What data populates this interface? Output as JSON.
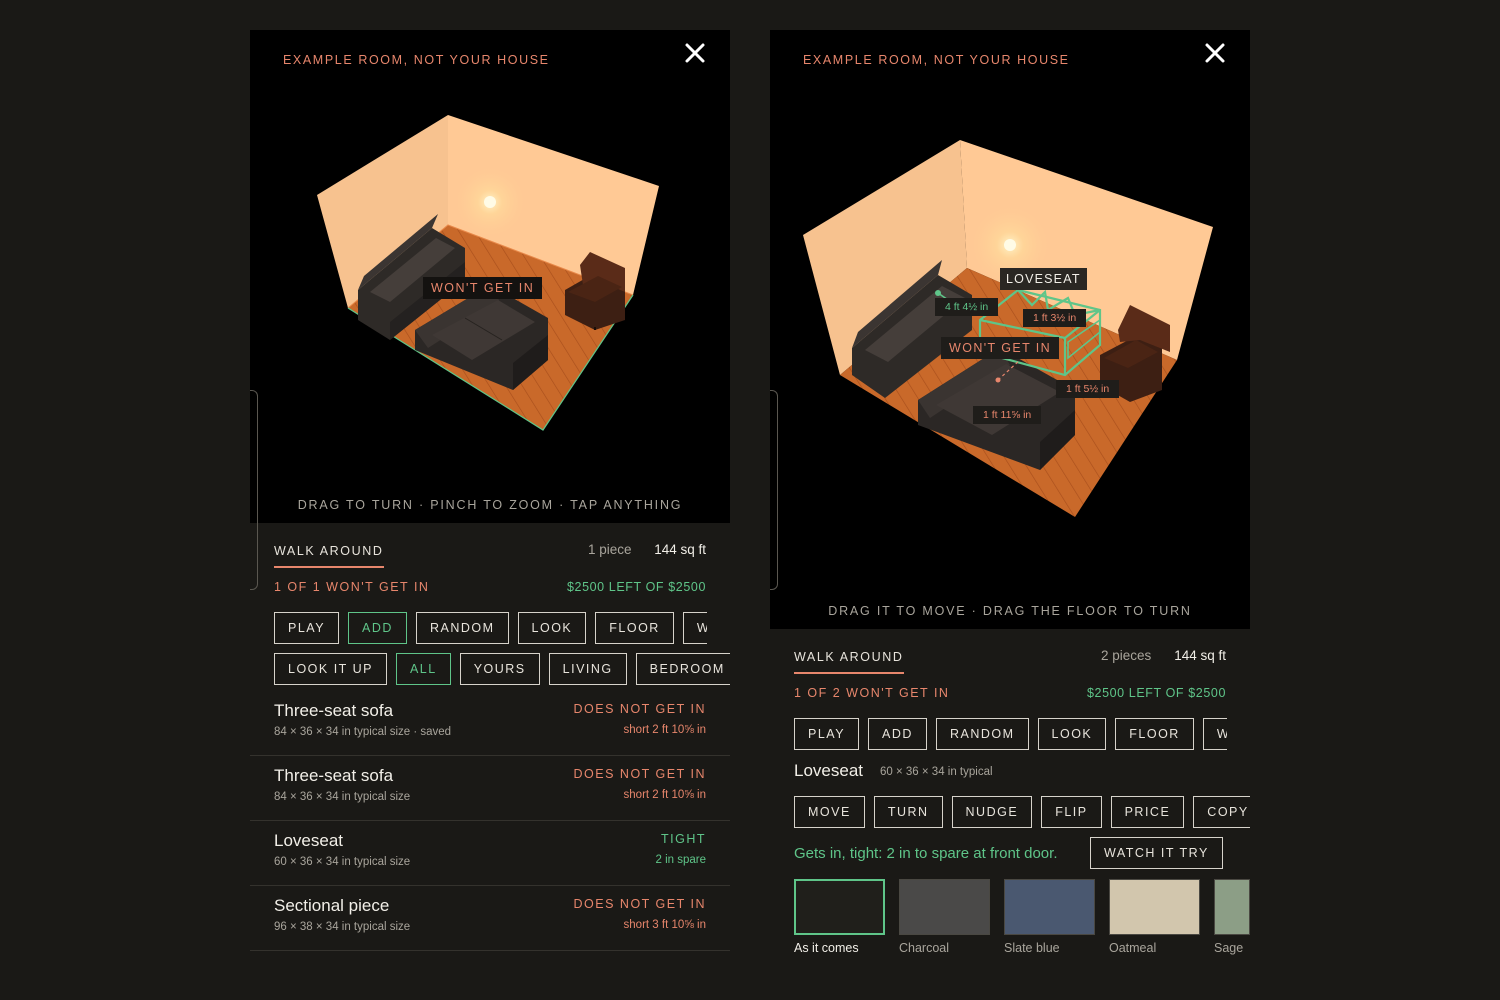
{
  "left": {
    "scene_title": "EXAMPLE ROOM, NOT YOUR HOUSE",
    "close_icon": "close-icon",
    "wont_label": "WON'T GET IN",
    "hint": "DRAG TO TURN · PINCH TO ZOOM · TAP ANYTHING",
    "tab": "WALK AROUND",
    "piece_count": "1 piece",
    "area": "144 sq ft",
    "status_left": "1 OF 1 WON'T GET IN",
    "status_right": "$2500 LEFT OF $2500",
    "actions": [
      "PLAY",
      "ADD",
      "RANDOM",
      "LOOK",
      "FLOOR",
      "WAL"
    ],
    "filters": [
      "LOOK IT UP",
      "ALL",
      "YOURS",
      "LIVING",
      "BEDROOM",
      ""
    ],
    "items": [
      {
        "name": "Three-seat sofa",
        "sub": "84 × 36 × 34 in  typical size  · saved",
        "status": "DOES NOT GET IN",
        "detail": "short 2 ft 10⅝ in",
        "ok": false
      },
      {
        "name": "Three-seat sofa",
        "sub": "84 × 36 × 34 in  typical size",
        "status": "DOES NOT GET IN",
        "detail": "short 2 ft 10⅝ in",
        "ok": false
      },
      {
        "name": "Loveseat",
        "sub": "60 × 36 × 34 in  typical size",
        "status": "TIGHT",
        "detail": "2 in spare",
        "ok": true
      },
      {
        "name": "Sectional piece",
        "sub": "96 × 38 × 34 in  typical size",
        "status": "DOES NOT GET IN",
        "detail": "short 3 ft 10⅝ in",
        "ok": false
      }
    ]
  },
  "right": {
    "scene_title": "EXAMPLE ROOM, NOT YOUR HOUSE",
    "close_icon": "close-icon",
    "loveseat_label": "LOVESEAT",
    "wont_label": "WON'T GET IN",
    "dims": [
      "4 ft 4½ in",
      "1 ft 3½ in",
      "1 ft 5½ in",
      "1 ft 11⅝ in"
    ],
    "hint": "DRAG IT TO MOVE · DRAG THE FLOOR TO TURN",
    "tab": "WALK AROUND",
    "piece_count": "2 pieces",
    "area": "144 sq ft",
    "status_left": "1 OF 2 WON'T GET IN",
    "status_right": "$2500 LEFT OF $2500",
    "actions": [
      "PLAY",
      "ADD",
      "RANDOM",
      "LOOK",
      "FLOOR",
      "WAL"
    ],
    "selected_name": "Loveseat",
    "selected_dims": "60 × 36 × 34 in  typical",
    "tools": [
      "MOVE",
      "TURN",
      "NUDGE",
      "FLIP",
      "PRICE",
      "COPY"
    ],
    "message": "Gets in, tight: 2 in to spare at front door.",
    "watch_btn": "WATCH IT TRY",
    "swatches": [
      {
        "label": "As it comes",
        "color": "#201f1b"
      },
      {
        "label": "Charcoal",
        "color": "#4a4948"
      },
      {
        "label": "Slate blue",
        "color": "#4a5870"
      },
      {
        "label": "Oatmeal",
        "color": "#d2c6ad"
      },
      {
        "label": "Sage",
        "color": "#8c9e86"
      }
    ]
  },
  "colors": {
    "accent_red": "#e7866c",
    "accent_green": "#5fc589",
    "background": "#1a1916",
    "scene": "#000000"
  }
}
